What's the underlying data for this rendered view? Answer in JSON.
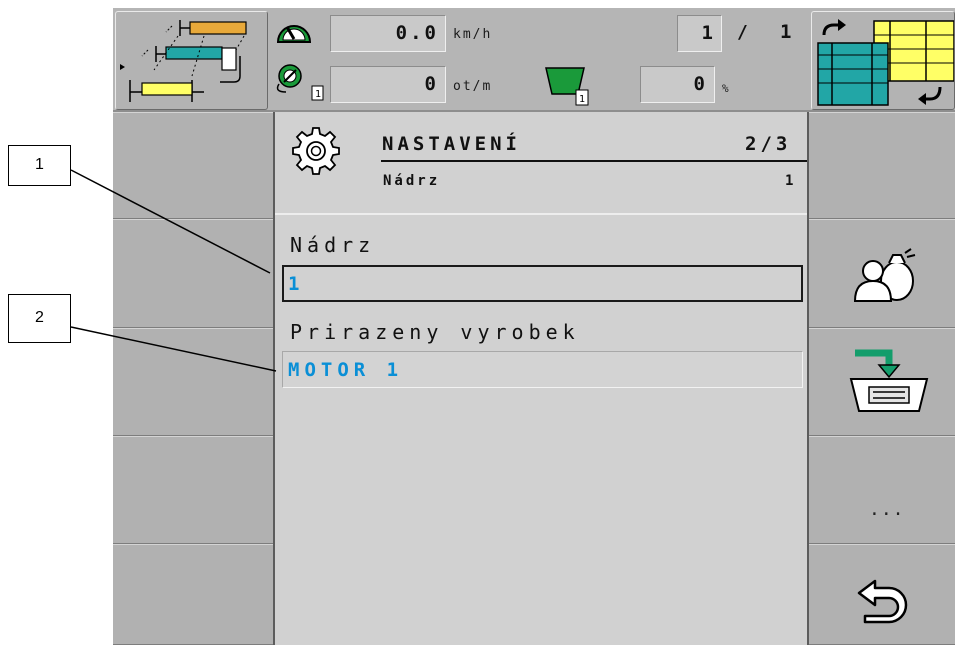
{
  "speed": {
    "value": "0.0",
    "unit": "km/h"
  },
  "rpm": {
    "value": "0",
    "unit": "ot/m"
  },
  "section": {
    "current": "1",
    "total": "1"
  },
  "hopper": {
    "value": "0",
    "unit": "%"
  },
  "header": {
    "title": "NASTAVENÍ",
    "page": "2/3",
    "subtitle": "Nádrz",
    "subtitle_value": "1"
  },
  "form": {
    "tank_label": "Nádrz",
    "tank_value": "1",
    "product_label": "Prirazeny vyrobek",
    "product_value": "MOTOR 1"
  },
  "softkeys": {
    "more": "..."
  },
  "callouts": [
    "1",
    "2"
  ]
}
